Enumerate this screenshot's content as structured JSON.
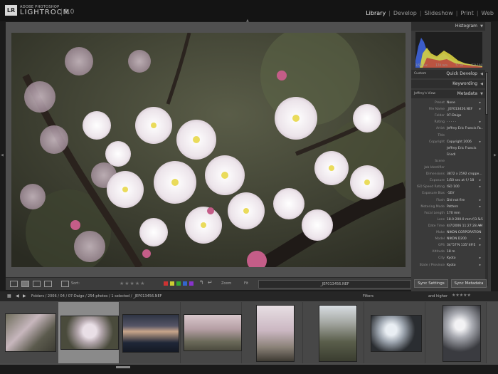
{
  "app": {
    "logo_letters": "LR",
    "brand_small": "ADOBE PHOTOSHOP",
    "brand_main": "LIGHTROOM",
    "version": "1.0"
  },
  "modules": [
    "Library",
    "Develop",
    "Slideshow",
    "Print",
    "Web"
  ],
  "active_module": "Library",
  "toolbar": {
    "sort_label": "Sort:",
    "zoom_label": "Zoom",
    "fit_label": "Fit",
    "filename": "_JEF013456.NEF",
    "stars": "★★★★★",
    "label_colors": [
      "#c33",
      "#cc3",
      "#3a3",
      "#36c",
      "#83c"
    ]
  },
  "right_panel": {
    "histogram_title": "Histogram",
    "histogram_labels": [
      "1/50 sec",
      "170 mm",
      "f / 18",
      "ISO 100"
    ],
    "custom_label": "Custom",
    "quick_develop": "Quick Develop",
    "keywording": "Keywording",
    "metadata": "Metadata",
    "metadata_preset_view": "Jeffrey's View",
    "rows": [
      {
        "k": "Preset",
        "v": "None"
      },
      {
        "k": "File Name",
        "v": "_JEF013456.NEF"
      },
      {
        "k": "Folder",
        "v": "07-Daigo"
      },
      {
        "k": "Rating",
        "v": "· · · · ·"
      },
      {
        "k": "Artist",
        "v": "Jeffrey Eric Francis Fr..."
      },
      {
        "k": "Title",
        "v": ""
      },
      {
        "k": "Copyright",
        "v": "Copyright 2006"
      },
      {
        "k": "",
        "v": "Jeffrey Eric Francis"
      },
      {
        "k": "",
        "v": "Friedl"
      },
      {
        "k": "Scene",
        "v": ""
      },
      {
        "k": "Job Identifier",
        "v": ""
      },
      {
        "k": "Dimensions",
        "v": "3872 x 2592 croppe..."
      },
      {
        "k": "Exposure",
        "v": "1/50 sec at f / 18"
      },
      {
        "k": "ISO Speed Rating",
        "v": "ISO 100"
      },
      {
        "k": "Exposure Bias",
        "v": "-1EV"
      },
      {
        "k": "Flash",
        "v": "Did not fire"
      },
      {
        "k": "Metering Mode",
        "v": "Pattern"
      },
      {
        "k": "Focal Length",
        "v": "170 mm"
      },
      {
        "k": "Lens",
        "v": "18.0-200.0 mm f/3.5-5"
      },
      {
        "k": "Date Time",
        "v": "4/7/2006 11:27:28 AM"
      },
      {
        "k": "Make",
        "v": "NIKON CORPORATION"
      },
      {
        "k": "Model",
        "v": "NIKON D200"
      },
      {
        "k": "GPS",
        "v": "34°57'N 135°49'E"
      },
      {
        "k": "Altitude",
        "v": "18 m"
      },
      {
        "k": "City",
        "v": "Kyoto"
      },
      {
        "k": "State / Province",
        "v": "Kyoto"
      }
    ],
    "sync_settings": "Sync Settings",
    "sync_metadata": "Sync Metadata"
  },
  "filmstrip": {
    "path": "Folders / 2006 / 04 / 07-Daigo / 254 photos / 1 selected / _JEF013456.NEF",
    "filters_label": "Filters",
    "rating_filter": "and higher",
    "filter_stars": "★★★★★",
    "selected_index": 1
  }
}
